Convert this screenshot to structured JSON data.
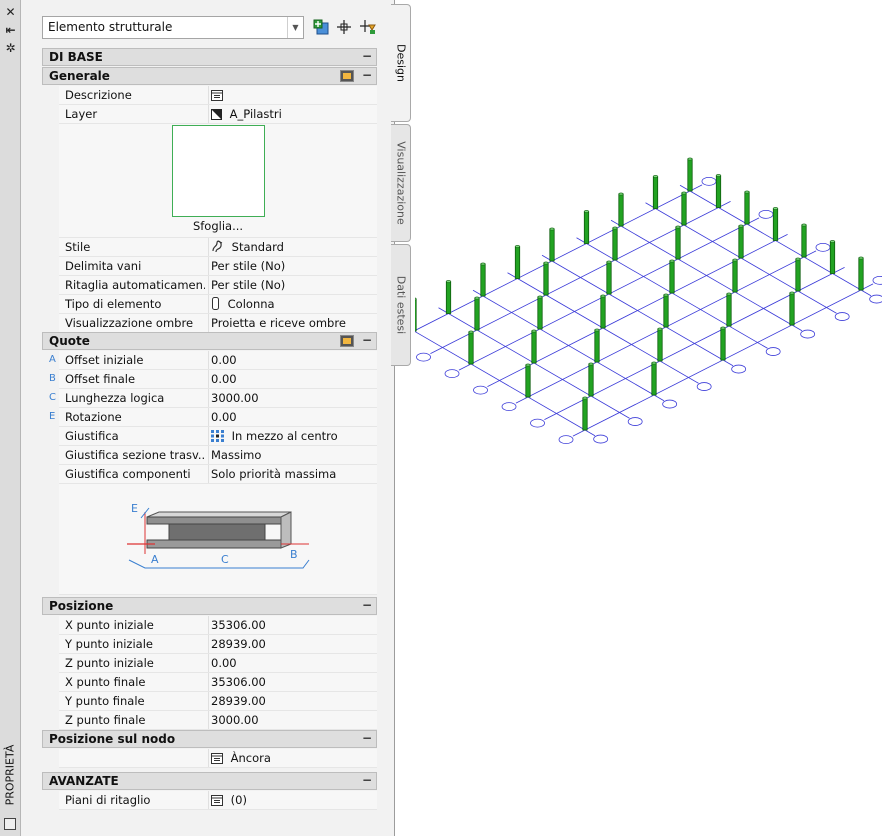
{
  "palette_title": "PROPRIETÀ",
  "selector": {
    "value": "Elemento strutturale"
  },
  "tabs": [
    "Design",
    "Visualizzazione",
    "Dati estesi"
  ],
  "sections": {
    "base": "DI BASE",
    "generale": "Generale",
    "quote": "Quote",
    "posizione": "Posizione",
    "posizione_nodo": "Posizione sul nodo",
    "avanzate": "AVANZATE"
  },
  "generale_rows": [
    {
      "label": "Descrizione",
      "value": ""
    },
    {
      "label": "Layer",
      "value": "A_Pilastri"
    }
  ],
  "sfoglia_label": "Sfoglia...",
  "generale_rows2": [
    {
      "label": "Stile",
      "value": "Standard"
    },
    {
      "label": "Delimita vani",
      "value": "Per stile (No)"
    },
    {
      "label": "Ritaglia  automaticamen...",
      "value": "Per stile (No)"
    },
    {
      "label": "Tipo di elemento",
      "value": "Colonna"
    },
    {
      "label": "Visualizzazione ombre",
      "value": "Proietta e riceve ombre"
    }
  ],
  "quote_rows": [
    {
      "letter": "A",
      "label": "Offset iniziale",
      "value": "0.00"
    },
    {
      "letter": "B",
      "label": "Offset finale",
      "value": "0.00"
    },
    {
      "letter": "C",
      "label": "Lunghezza logica",
      "value": "3000.00"
    },
    {
      "letter": "E",
      "label": "Rotazione",
      "value": "0.00"
    },
    {
      "letter": "",
      "label": "Giustifica",
      "value": "In mezzo al centro"
    },
    {
      "letter": "",
      "label": "Giustifica  sezione  trasv...",
      "value": "Massimo"
    },
    {
      "letter": "",
      "label": "Giustifica componenti",
      "value": "Solo priorità massima"
    }
  ],
  "beam_labels": {
    "e": "E",
    "a": "A",
    "c": "C",
    "b": "B"
  },
  "posizione_rows": [
    {
      "label": "X punto iniziale",
      "value": "35306.00"
    },
    {
      "label": "Y punto iniziale",
      "value": "28939.00"
    },
    {
      "label": "Z punto iniziale",
      "value": "0.00"
    },
    {
      "label": "X punto finale",
      "value": "35306.00"
    },
    {
      "label": "Y punto finale",
      "value": "28939.00"
    },
    {
      "label": "Z punto finale",
      "value": "3000.00"
    }
  ],
  "nodo_rows": [
    {
      "label": "",
      "value": "Àncora"
    }
  ],
  "avanzate_rows": [
    {
      "label": "Piani di ritaglio",
      "value": "(0)"
    }
  ],
  "colors": {
    "grid_line": "#3a3ad8",
    "column": "#22a322",
    "accent": "#3a7fd0"
  }
}
